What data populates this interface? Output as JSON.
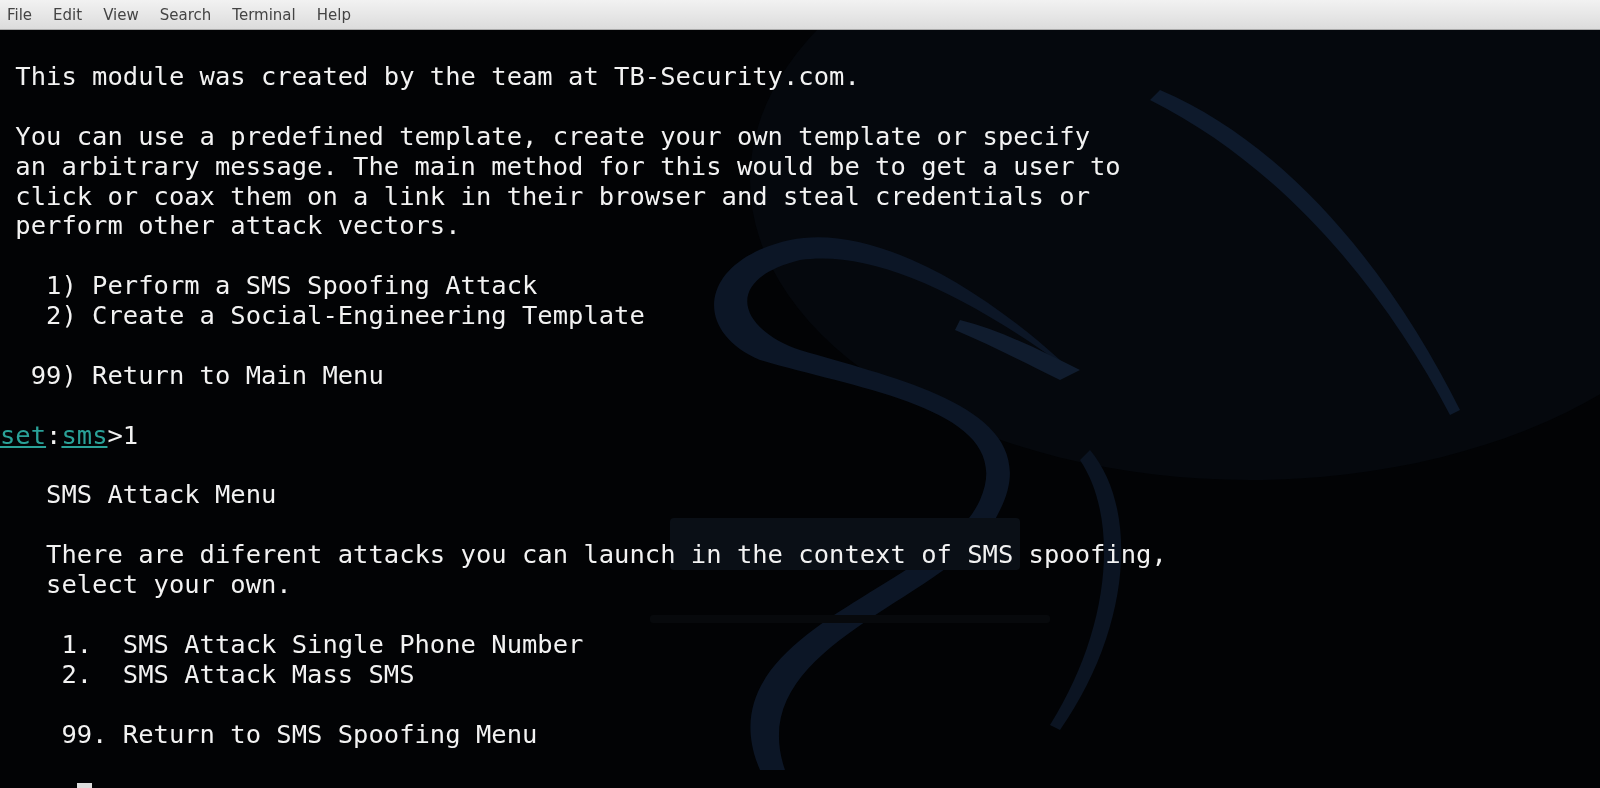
{
  "menu_bar": [
    "File",
    "Edit",
    "View",
    "Search",
    "Terminal",
    "Help"
  ],
  "terminal_lines": [
    {
      "kind": "text",
      "text": " This module was created by the team at TB-Security.com."
    },
    {
      "kind": "blank"
    },
    {
      "kind": "text",
      "text": " You can use a predefined template, create your own template or specify"
    },
    {
      "kind": "text",
      "text": " an arbitrary message. The main method for this would be to get a user to"
    },
    {
      "kind": "text",
      "text": " click or coax them on a link in their browser and steal credentials or"
    },
    {
      "kind": "text",
      "text": " perform other attack vectors."
    },
    {
      "kind": "blank"
    },
    {
      "kind": "text",
      "text": "   1) Perform a SMS Spoofing Attack"
    },
    {
      "kind": "text",
      "text": "   2) Create a Social-Engineering Template"
    },
    {
      "kind": "blank"
    },
    {
      "kind": "text",
      "text": "  99) Return to Main Menu"
    },
    {
      "kind": "blank"
    },
    {
      "kind": "prompt",
      "app": "set",
      "sep": ":",
      "module": "sms",
      "end": ">",
      "input": "1"
    },
    {
      "kind": "blank"
    },
    {
      "kind": "text",
      "text": "   SMS Attack Menu"
    },
    {
      "kind": "blank"
    },
    {
      "kind": "text",
      "text": "   There are diferent attacks you can launch in the context of SMS spoofing,"
    },
    {
      "kind": "text",
      "text": "   select your own."
    },
    {
      "kind": "blank"
    },
    {
      "kind": "text",
      "text": "    1.  SMS Attack Single Phone Number"
    },
    {
      "kind": "text",
      "text": "    2.  SMS Attack Mass SMS"
    },
    {
      "kind": "blank"
    },
    {
      "kind": "text",
      "text": "    99. Return to SMS Spoofing Menu"
    },
    {
      "kind": "blank"
    },
    {
      "kind": "cursor"
    }
  ]
}
